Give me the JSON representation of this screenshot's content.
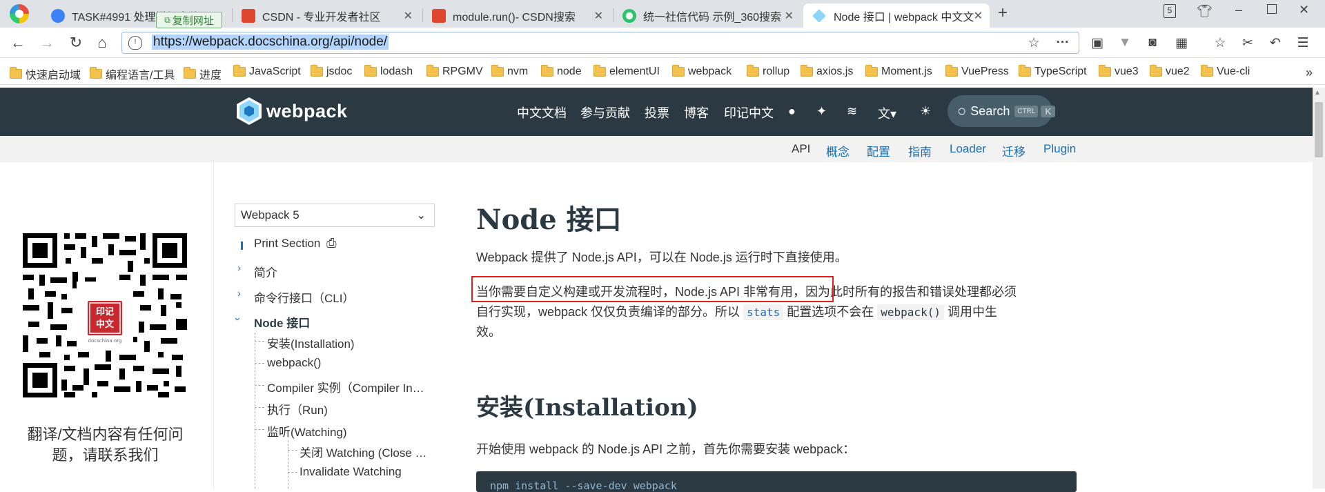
{
  "browser": {
    "tabs": [
      {
        "title": "TASK#4991 处理增加字体运 M",
        "close": "✕"
      },
      {
        "title": "CSDN - 专业开发者社区",
        "close": "✕"
      },
      {
        "title": "module.run()- CSDN搜索",
        "close": "✕"
      },
      {
        "title": "统一社信代码 示例_360搜索",
        "close": "✕"
      },
      {
        "title": "Node 接口 | webpack 中文文",
        "close": "✕"
      }
    ],
    "new_tab": "+",
    "tab_count": "5",
    "copy_tip": "复制网址",
    "url": "https://webpack.docschina.org/api/node/",
    "bookmarks": [
      "快速启动域",
      "编程语言/工具",
      "进度",
      "JavaScript",
      "jsdoc",
      "lodash",
      "RPGMV",
      "nvm",
      "node",
      "elementUI",
      "webpack",
      "rollup",
      "axios.js",
      "Moment.js",
      "VuePress",
      "TypeScript",
      "vue3",
      "vue2",
      "Vue-cli"
    ],
    "bookmarks_more": "»",
    "colors": {
      "tabbar": "#dfe3e8",
      "url_highlight": "#b3d4fc"
    }
  },
  "site": {
    "logo_text": "webpack",
    "nav": [
      "中文文档",
      "参与贡献",
      "投票",
      "博客",
      "印记中文"
    ],
    "search_label": "Search",
    "search_kbd": [
      "CTRL",
      "K"
    ],
    "subnav": [
      "API",
      "概念",
      "配置",
      "指南",
      "Loader",
      "迁移",
      "Plugin"
    ],
    "colors": {
      "header": "#2b3a42",
      "link": "#1a6fb5",
      "highlight_box": "#e02020"
    }
  },
  "promo": {
    "qr_badge_top": "印记",
    "qr_badge_bottom": "中文",
    "qr_badge_url": "docschina.org",
    "note": "翻译/文档内容有任何问题，请联系我们"
  },
  "sidebar": {
    "version": "Webpack 5",
    "print_section": "Print Section",
    "items": [
      "简介",
      "命令行接口（CLI）",
      "Node 接口"
    ],
    "subitems": [
      "安装(Installation)",
      "webpack()",
      "Compiler 实例（Compiler In…",
      "执行（Run)",
      "监听(Watching)"
    ],
    "subsubitems": [
      "关闭 Watching (Close …",
      "Invalidate Watching"
    ]
  },
  "content": {
    "title": "Node 接口",
    "intro": "Webpack 提供了 Node.js API，可以在 Node.js 运行时下直接使用。",
    "para2_highlight": "当你需要自定义构建或开发流程时，Node.js API 非常有用，",
    "para2_rest": "因为此时所有的报告和错误处理都必须",
    "para2_line2_a": "自行实现，webpack 仅仅负责编译的部分。所以",
    "para2_code1": "stats",
    "para2_line2_b": "配置选项不会在",
    "para2_code2": "webpack()",
    "para2_line2_c": "调用中生",
    "para2_line3": "效。",
    "section_title": "安装(Installation)",
    "section_intro": "开始使用 webpack 的 Node.js API 之前，首先你需要安装 webpack：",
    "code": "npm install --save-dev webpack"
  }
}
